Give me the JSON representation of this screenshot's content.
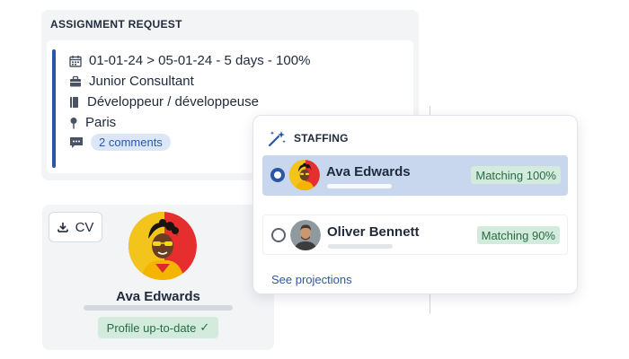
{
  "assignment": {
    "title": "ASSIGNMENT REQUEST",
    "dates": "01-01-24 > 05-01-24 - 5 days - 100%",
    "seniority": "Junior Consultant",
    "job": "Développeur / développeuse",
    "location": "Paris",
    "comments": "2 comments"
  },
  "profile": {
    "cv_label": "CV",
    "name": "Ava Edwards",
    "status": "Profile up-to-date",
    "status_check": "✓"
  },
  "staffing": {
    "title": "STAFFING",
    "candidates": [
      {
        "name": "Ava Edwards",
        "match": "Matching 100%",
        "selected": true
      },
      {
        "name": "Oliver Bennett",
        "match": "Matching 90%",
        "selected": false
      }
    ],
    "see_projections": "See projections"
  },
  "colors": {
    "accent": "#2b56a8",
    "selected_row": "#c8d6ee",
    "match_badge_bg": "#d3ebdc",
    "match_badge_text": "#2a6a45",
    "card_bg": "#f3f4f6"
  },
  "icons": [
    "calendar-icon",
    "briefcase-icon",
    "book-icon",
    "pin-icon",
    "chat-icon",
    "download-icon",
    "magic-wand-icon",
    "check-icon"
  ]
}
